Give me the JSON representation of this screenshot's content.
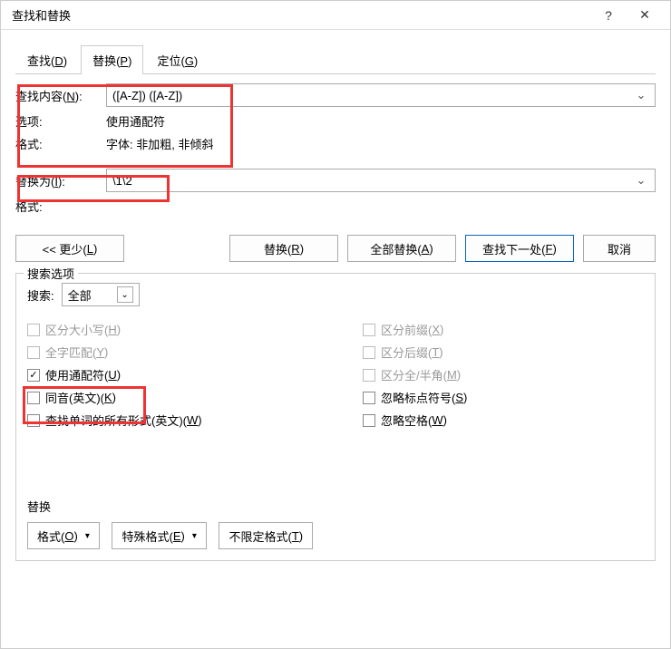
{
  "title": "查找和替换",
  "help": "?",
  "close": "✕",
  "tabs": [
    {
      "label": "查找(",
      "hot": "D",
      "suffix": ")"
    },
    {
      "label": "替换(",
      "hot": "P",
      "suffix": ")"
    },
    {
      "label": "定位(",
      "hot": "G",
      "suffix": ")"
    }
  ],
  "find": {
    "label_pre": "查找内容(",
    "hot": "N",
    "label_post": "):",
    "value": "([A-Z]) ([A-Z])"
  },
  "options_row": {
    "label": "选项:",
    "value": "使用通配符"
  },
  "format_row": {
    "label": "格式:",
    "value": "字体: 非加粗, 非倾斜"
  },
  "replace": {
    "label_pre": "替换为(",
    "hot": "I",
    "label_post": "):",
    "value": "\\1\\2"
  },
  "format2_label": "格式:",
  "buttons": {
    "less_pre": "<< 更少(",
    "less_hot": "L",
    "repl_pre": "替换(",
    "repl_hot": "R",
    "replall_pre": "全部替换(",
    "replall_hot": "A",
    "next_pre": "查找下一处(",
    "next_hot": "F",
    "cancel": "取消"
  },
  "search_options": {
    "legend": "搜索选项",
    "search_label": "搜索:",
    "search_value": "全部",
    "left": {
      "matchcase": {
        "pre": "区分大小写(",
        "hot": "H",
        "post": ")",
        "disabled": true,
        "checked": false
      },
      "wholeword": {
        "pre": "全字匹配(",
        "hot": "Y",
        "post": ")",
        "disabled": true,
        "checked": false
      },
      "wildcards": {
        "pre": "使用通配符(",
        "hot": "U",
        "post": ")",
        "disabled": false,
        "checked": true
      },
      "sounds": {
        "pre": "同音(英文)(",
        "hot": "K",
        "post": ")",
        "disabled": false,
        "checked": false
      },
      "allforms": {
        "pre": "查找单词的所有形式(英文)(",
        "hot": "W",
        "post": ")",
        "disabled": false,
        "checked": false
      }
    },
    "right": {
      "prefix": {
        "pre": "区分前缀(",
        "hot": "X",
        "post": ")",
        "disabled": true,
        "checked": false
      },
      "suffix": {
        "pre": "区分后缀(",
        "hot": "T",
        "post": ")",
        "disabled": true,
        "checked": false
      },
      "fullhalf": {
        "pre": "区分全/半角(",
        "hot": "M",
        "post": ")",
        "disabled": true,
        "checked": false
      },
      "punct": {
        "pre": "忽略标点符号(",
        "hot": "S",
        "post": ")",
        "disabled": false,
        "checked": false
      },
      "space": {
        "pre": "忽略空格(",
        "hot": "W",
        "post": ")",
        "disabled": false,
        "checked": false
      }
    }
  },
  "replace_section": {
    "label": "替换",
    "format": {
      "pre": "格式(",
      "hot": "O",
      "post": ")"
    },
    "special": {
      "pre": "特殊格式(",
      "hot": "E",
      "post": ")"
    },
    "nofmt": {
      "pre": "不限定格式(",
      "hot": "T",
      "post": ")"
    }
  },
  "chevron": "⌄",
  "caret": "▾",
  "check": "✓"
}
